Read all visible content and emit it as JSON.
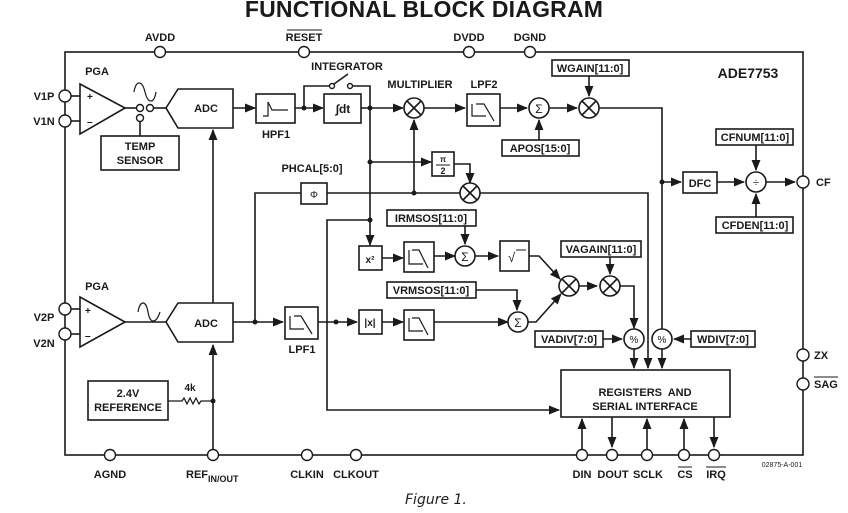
{
  "title": "FUNCTIONAL BLOCK DIAGRAM",
  "caption": "Figure 1.",
  "chip_name": "ADE7753",
  "drawing_id": "02875-A-001",
  "pins": {
    "top": [
      "AVDD",
      "RESET",
      "DVDD",
      "DGND"
    ],
    "left": [
      "V1P",
      "V1N",
      "V2P",
      "V2N"
    ],
    "right": [
      "CF",
      "ZX",
      "SAG"
    ],
    "bottom": [
      "AGND",
      "REF",
      "CLKIN",
      "CLKOUT",
      "DIN",
      "DOUT",
      "SCLK",
      "CS",
      "IRQ"
    ],
    "ref_subscript": "IN/OUT",
    "overlined": [
      "RESET",
      "SAG",
      "CS",
      "IRQ"
    ]
  },
  "blocks": {
    "pga1": "PGA",
    "pga2": "PGA",
    "adc1": "ADC",
    "adc2": "ADC",
    "temp_sensor": [
      "TEMP",
      "SENSOR"
    ],
    "hpf1": "HPF1",
    "integrator": "INTEGRATOR",
    "integrator_symbol": "∫dt",
    "multiplier": "MULTIPLIER",
    "lpf2": "LPF2",
    "lpf1": "LPF1",
    "phase_symbol": "Φ",
    "pi_over_2": [
      "π",
      "2"
    ],
    "square": "x²",
    "abs": "|x|",
    "sqrt": "√",
    "dfc": "DFC",
    "reference": [
      "2.4V",
      "REFERENCE"
    ],
    "resistor": "4k",
    "registers": [
      "REGISTERS  AND",
      "SERIAL INTERFACE"
    ]
  },
  "registers": {
    "wgain": "WGAIN[11:0]",
    "apos": "APOS[15:0]",
    "phcal": "PHCAL[5:0]",
    "irmsos": "IRMSOS[11:0]",
    "vrmsos": "VRMSOS[11:0]",
    "vagain": "VAGAIN[11:0]",
    "vadiv": "VADIV[7:0]",
    "wdiv": "WDIV[7:0]",
    "cfnum": "CFNUM[11:0]",
    "cfden": "CFDEN[11:0]"
  },
  "operators": {
    "sum": "Σ",
    "divide": "%",
    "cf_divide": "÷",
    "plus": "+",
    "minus": "–"
  }
}
